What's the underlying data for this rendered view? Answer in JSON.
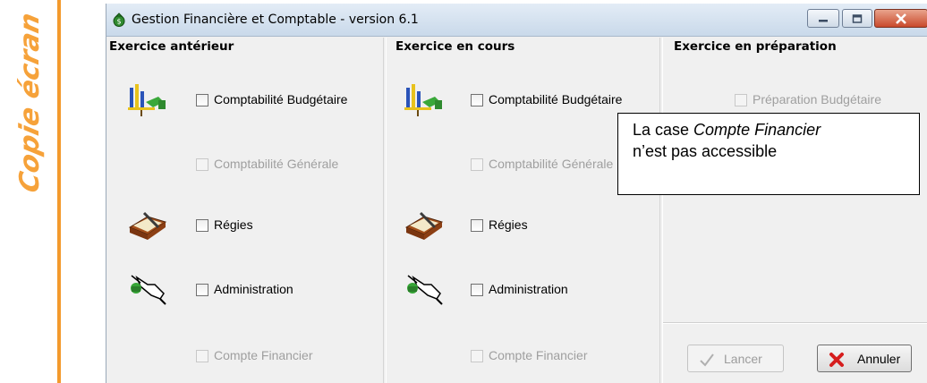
{
  "side_label": "Copie écran",
  "window": {
    "title": "Gestion Financière et Comptable - version 6.1"
  },
  "columns": [
    {
      "title": "Exercice antérieur",
      "items": [
        {
          "icon": "budget-chart-icon",
          "label": "Comptabilité Budgétaire",
          "enabled": true
        },
        {
          "icon": "",
          "label": "Comptabilité Générale",
          "enabled": false
        },
        {
          "icon": "book-pen-icon",
          "label": "Régies",
          "enabled": true
        },
        {
          "icon": "hand-cursor-icon",
          "label": "Administration",
          "enabled": true
        },
        {
          "icon": "",
          "label": "Compte Financier",
          "enabled": false
        }
      ]
    },
    {
      "title": "Exercice en cours",
      "items": [
        {
          "icon": "budget-chart-icon",
          "label": "Comptabilité Budgétaire",
          "enabled": true
        },
        {
          "icon": "",
          "label": "Comptabilité Générale",
          "enabled": false
        },
        {
          "icon": "book-pen-icon",
          "label": "Régies",
          "enabled": true
        },
        {
          "icon": "hand-cursor-icon",
          "label": "Administration",
          "enabled": true
        },
        {
          "icon": "",
          "label": "Compte Financier",
          "enabled": false
        }
      ]
    },
    {
      "title": "Exercice en préparation",
      "items": [
        {
          "icon": "",
          "label": "Préparation Budgétaire",
          "enabled": false
        }
      ]
    }
  ],
  "buttons": {
    "lancer": "Lancer",
    "annuler": "Annuler"
  },
  "callout": {
    "text_before": "La case ",
    "text_em": "Compte Financier",
    "text_after": "n’est pas accessible"
  },
  "colors": {
    "accent_orange": "#f39a2d",
    "title_bar": "#d6e3f1"
  }
}
